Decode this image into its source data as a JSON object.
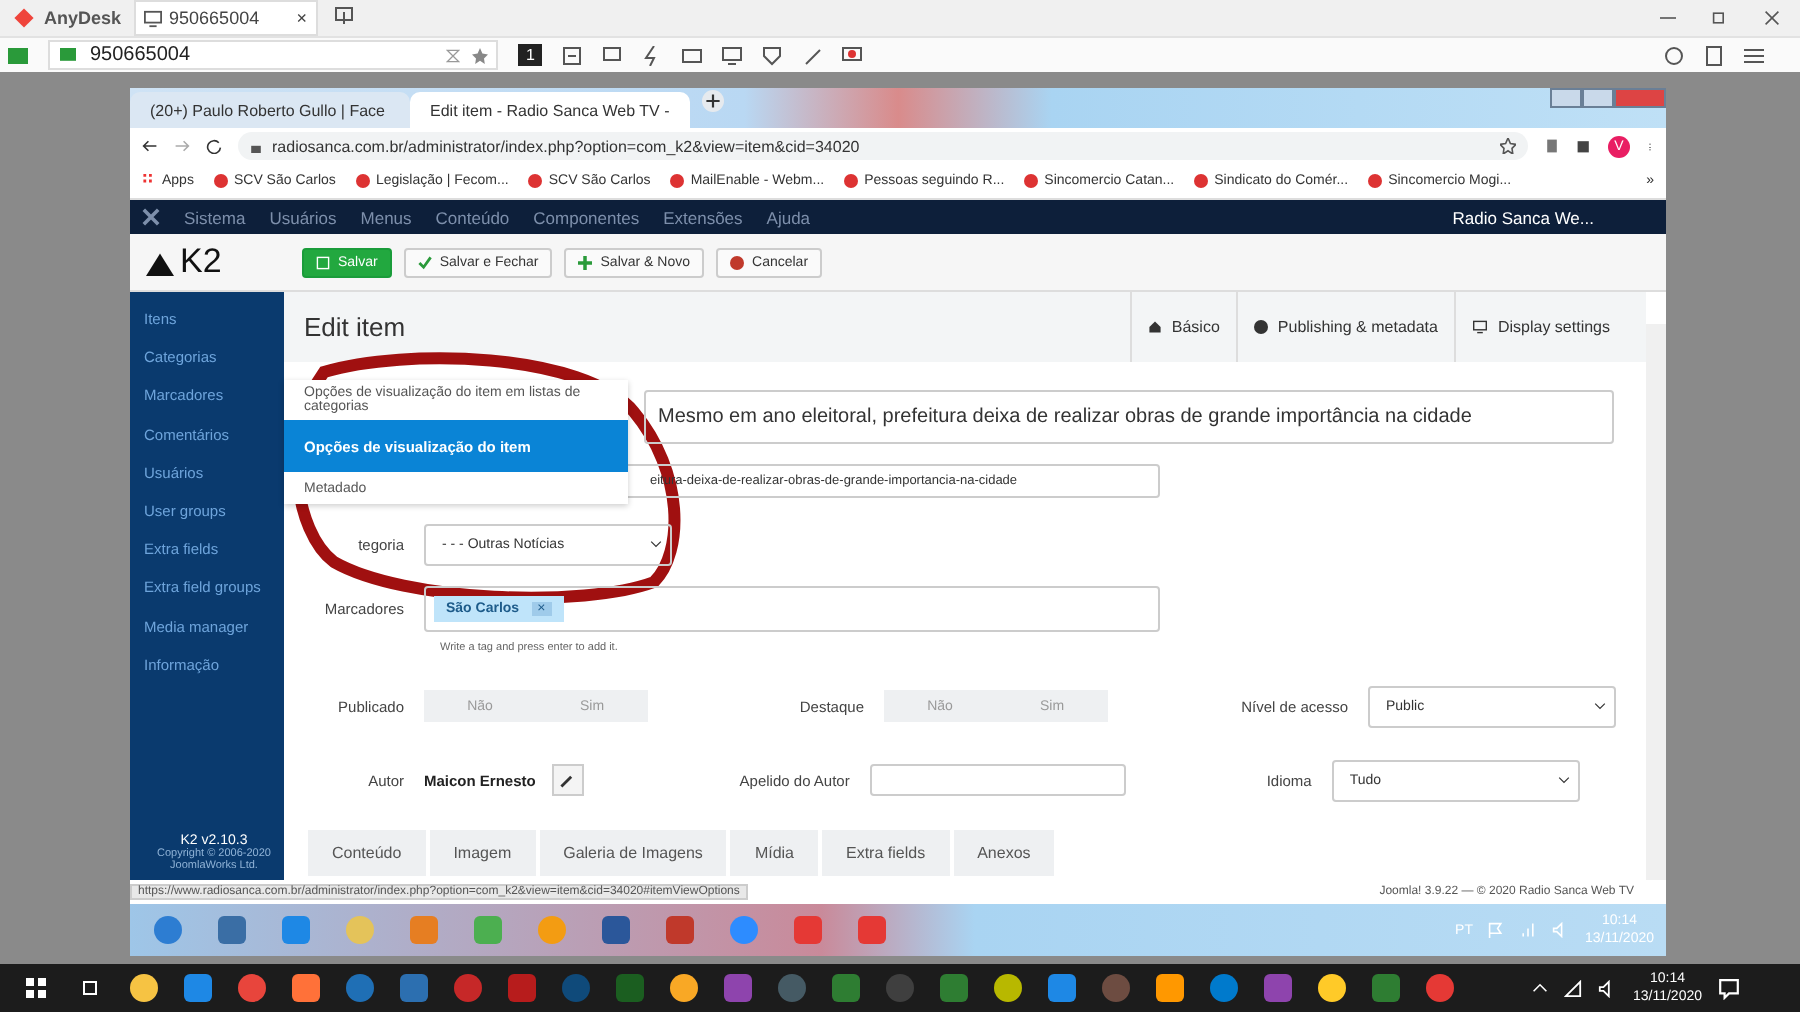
{
  "anydesk": {
    "app_name": "AnyDesk",
    "session_tab": {
      "label": "950665004",
      "close": "×"
    },
    "address": "950665004",
    "display_key": "1"
  },
  "browser": {
    "tabs": [
      {
        "label": "(20+) Paulo Roberto Gullo | Face",
        "selected": false
      },
      {
        "label": "Edit item - Radio Sanca Web TV -",
        "selected": true
      }
    ],
    "url": "radiosanca.com.br/administrator/index.php?option=com_k2&view=item&cid=34020",
    "bookmarks": [
      "Apps",
      "SCV São Carlos",
      "Legislação | Fecom...",
      "SCV São Carlos",
      "MailEnable - Webm...",
      "Pessoas seguindo R...",
      "Sincomercio Catan...",
      "Sindicato do Comér...",
      "Sincomercio Mogi...",
      "»"
    ],
    "profile": "V"
  },
  "joomla_menu": {
    "items": [
      "Sistema",
      "Usuários",
      "Menus",
      "Conteúdo",
      "Componentes",
      "Extensões",
      "Ajuda"
    ],
    "site": "Radio Sanca We..."
  },
  "toolbar": {
    "logo": "K2",
    "buttons": [
      {
        "label": "Salvar",
        "kind": "primary"
      },
      {
        "label": "Salvar e Fechar",
        "kind": "check"
      },
      {
        "label": "Salvar & Novo",
        "kind": "plus"
      },
      {
        "label": "Cancelar",
        "kind": "cancel"
      }
    ]
  },
  "sidebar": {
    "items": [
      "Itens",
      "Categorias",
      "Marcadores",
      "Comentários",
      "Usuários",
      "User groups",
      "Extra fields",
      "Extra field groups",
      "Media manager",
      "Informação"
    ],
    "version": "K2 v2.10.3",
    "copyright": "Copyright © 2006-2020 JoomlaWorks Ltd."
  },
  "page": {
    "title": "Edit item",
    "tabs": [
      {
        "label": "Básico",
        "selected": false
      },
      {
        "label": "Publishing & metadata",
        "selected": false
      },
      {
        "label": "Display settings",
        "selected": false
      }
    ]
  },
  "menu": [
    {
      "label": "Opções de visualização do item em listas de categorias",
      "selected": false
    },
    {
      "label": "Opções de visualização do item",
      "selected": true
    },
    {
      "label": "Metadado",
      "selected": false
    }
  ],
  "form": {
    "title_value": "Mesmo em ano eleitoral, prefeitura deixa de realizar obras de grande importância na cidade",
    "alias_value": "eitura-deixa-de-realizar-obras-de-grande-importancia-na-cidade",
    "category_label": "tegoria",
    "category_value": "- - - Outras Notícias",
    "tags_label": "Marcadores",
    "tags": [
      "São Carlos"
    ],
    "tag_remove": "×",
    "tags_hint": "Write a tag and press enter to add it.",
    "published": {
      "label": "Publicado",
      "options": [
        {
          "label": "Não",
          "selected": false
        },
        {
          "label": "Sim",
          "selected": false
        }
      ]
    },
    "featured": {
      "label": "Destaque",
      "options": [
        {
          "label": "Não",
          "selected": false
        },
        {
          "label": "Sim",
          "selected": false
        }
      ]
    },
    "access": {
      "label": "Nível de acesso",
      "value": "Public"
    },
    "author": {
      "label": "Autor",
      "value": "Maicon Ernesto"
    },
    "author_alias": {
      "label": "Apelido do Autor"
    },
    "language": {
      "label": "Idioma",
      "value": "Tudo"
    },
    "tabs": [
      {
        "label": "Conteúdo",
        "selected": false
      },
      {
        "label": "Imagem",
        "selected": false
      },
      {
        "label": "Galeria de Imagens",
        "selected": false
      },
      {
        "label": "Mídia",
        "selected": false
      },
      {
        "label": "Extra fields",
        "selected": false
      },
      {
        "label": "Anexos",
        "selected": false
      }
    ]
  },
  "status_url": "https://www.radiosanca.com.br/administrator/index.php?option=com_k2&view=item&cid=34020#itemViewOptions",
  "footer": "Joomla! 3.9.22 — © 2020 Radio Sanca Web TV",
  "remote_taskbar": {
    "language": "PT",
    "time": "10:14",
    "date": "13/11/2020"
  },
  "local_taskbar": {
    "time": "10:14",
    "date": "13/11/2020"
  }
}
